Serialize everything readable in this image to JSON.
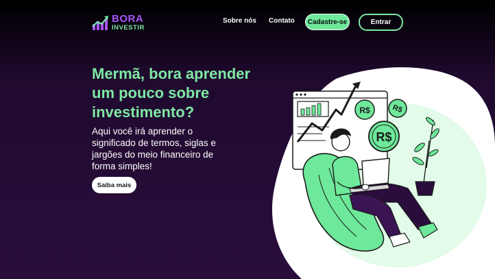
{
  "brand": {
    "name_line1": "BORA",
    "name_line2": "INVESTIR"
  },
  "nav": {
    "about": "Sobre nós",
    "contact": "Contato",
    "signup": "Cadastre-se",
    "login": "Entrar"
  },
  "hero": {
    "title": "Mermã, bora aprender um pouco sobre investimento?",
    "description": "Aqui você irá aprender o significado de termos, siglas e jargões do meio financeiro de forma simples!",
    "cta": "Saiba mais"
  },
  "illustration": {
    "coin_label": "R$"
  },
  "colors": {
    "background": "#2a0d3c",
    "accent_green": "#7ee8a4",
    "accent_purple": "#a855f7"
  }
}
